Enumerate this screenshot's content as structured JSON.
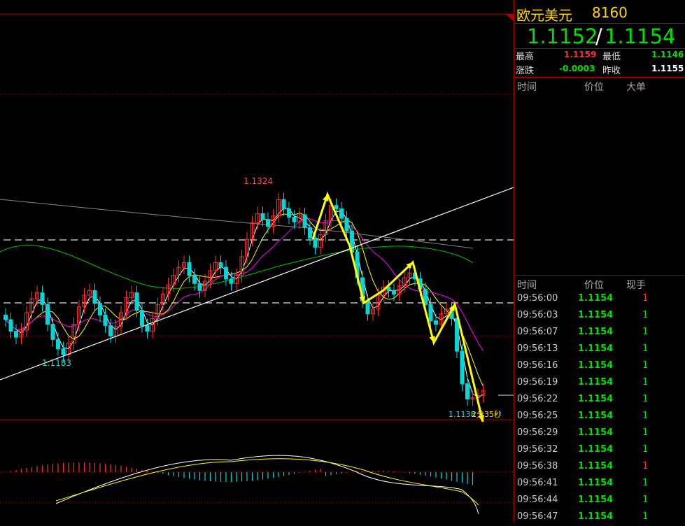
{
  "quote": {
    "name": "欧元美元",
    "code": "8160",
    "bid": "1.1152",
    "separator": "/",
    "ask": "1.1154",
    "high_label": "最高",
    "high_value": "1.1159",
    "low_label": "最低",
    "low_value": "1.1146",
    "change_label": "涨跌",
    "change_value": "-0.0003",
    "prev_close_label": "昨收",
    "prev_close_value": "1.1155"
  },
  "big_orders": {
    "headers": [
      "时间",
      "价位",
      "大单"
    ]
  },
  "ticks": {
    "headers": [
      "时间",
      "价位",
      "现手"
    ],
    "rows": [
      {
        "time": "09:56:00",
        "price": "1.1154",
        "vol": "1",
        "color": "#ff3030"
      },
      {
        "time": "09:56:03",
        "price": "1.1154",
        "vol": "1",
        "color": "#00e000"
      },
      {
        "time": "09:56:07",
        "price": "1.1154",
        "vol": "1",
        "color": "#00e000"
      },
      {
        "time": "09:56:13",
        "price": "1.1154",
        "vol": "1",
        "color": "#00e000"
      },
      {
        "time": "09:56:16",
        "price": "1.1154",
        "vol": "1",
        "color": "#00e000"
      },
      {
        "time": "09:56:19",
        "price": "1.1154",
        "vol": "1",
        "color": "#00e000"
      },
      {
        "time": "09:56:22",
        "price": "1.1154",
        "vol": "1",
        "color": "#00e000"
      },
      {
        "time": "09:56:25",
        "price": "1.1154",
        "vol": "1",
        "color": "#00e000"
      },
      {
        "time": "09:56:29",
        "price": "1.1154",
        "vol": "1",
        "color": "#00e000"
      },
      {
        "time": "09:56:32",
        "price": "1.1154",
        "vol": "1",
        "color": "#00e000"
      },
      {
        "time": "09:56:38",
        "price": "1.1154",
        "vol": "1",
        "color": "#ff3030"
      },
      {
        "time": "09:56:41",
        "price": "1.1154",
        "vol": "1",
        "color": "#00e000"
      },
      {
        "time": "09:56:44",
        "price": "1.1154",
        "vol": "1",
        "color": "#00e000"
      },
      {
        "time": "09:56:47",
        "price": "1.1154",
        "vol": "1",
        "color": "#00e000"
      }
    ]
  },
  "chart": {
    "high_label": "1.1324",
    "low_label": "1.1183",
    "last_label": "1.1138",
    "countdown": "2分35秒",
    "colors": {
      "up": "#ff3030",
      "down": "#00d8d8",
      "ma_short": "#ffffff",
      "ma_mid": "#ffff00",
      "ma_long1": "#ff00ff",
      "ma_long2": "#00c000",
      "ma_long3": "#888888",
      "annotation": "#ffff00",
      "grid": "#b00000"
    },
    "closes": [
      1.1213,
      1.1203,
      1.1198,
      1.1204,
      1.1219,
      1.1231,
      1.1236,
      1.1226,
      1.1209,
      1.1196,
      1.1188,
      1.1183,
      1.1193,
      1.1209,
      1.1224,
      1.1234,
      1.1238,
      1.1227,
      1.1217,
      1.1208,
      1.1199,
      1.1207,
      1.1219,
      1.1232,
      1.1236,
      1.1221,
      1.1208,
      1.1203,
      1.1214,
      1.1226,
      1.1235,
      1.1243,
      1.1251,
      1.1258,
      1.1262,
      1.1251,
      1.1244,
      1.1238,
      1.1246,
      1.1255,
      1.1262,
      1.1258,
      1.1248,
      1.1244,
      1.1251,
      1.1267,
      1.1282,
      1.1296,
      1.1304,
      1.1299,
      1.1293,
      1.1302,
      1.1316,
      1.1308,
      1.1301,
      1.1297,
      1.1303,
      1.1292,
      1.1283,
      1.1275,
      1.1286,
      1.1298,
      1.1311,
      1.1308,
      1.13,
      1.1289,
      1.1271,
      1.1249,
      1.1229,
      1.1218,
      1.1222,
      1.1234,
      1.1241,
      1.1238,
      1.1235,
      1.1242,
      1.1249,
      1.1253,
      1.1248,
      1.1239,
      1.1226,
      1.1212,
      1.1209,
      1.1218,
      1.1222,
      1.1214,
      1.1186,
      1.1158,
      1.1145,
      1.1146,
      1.1148,
      1.1152
    ]
  }
}
